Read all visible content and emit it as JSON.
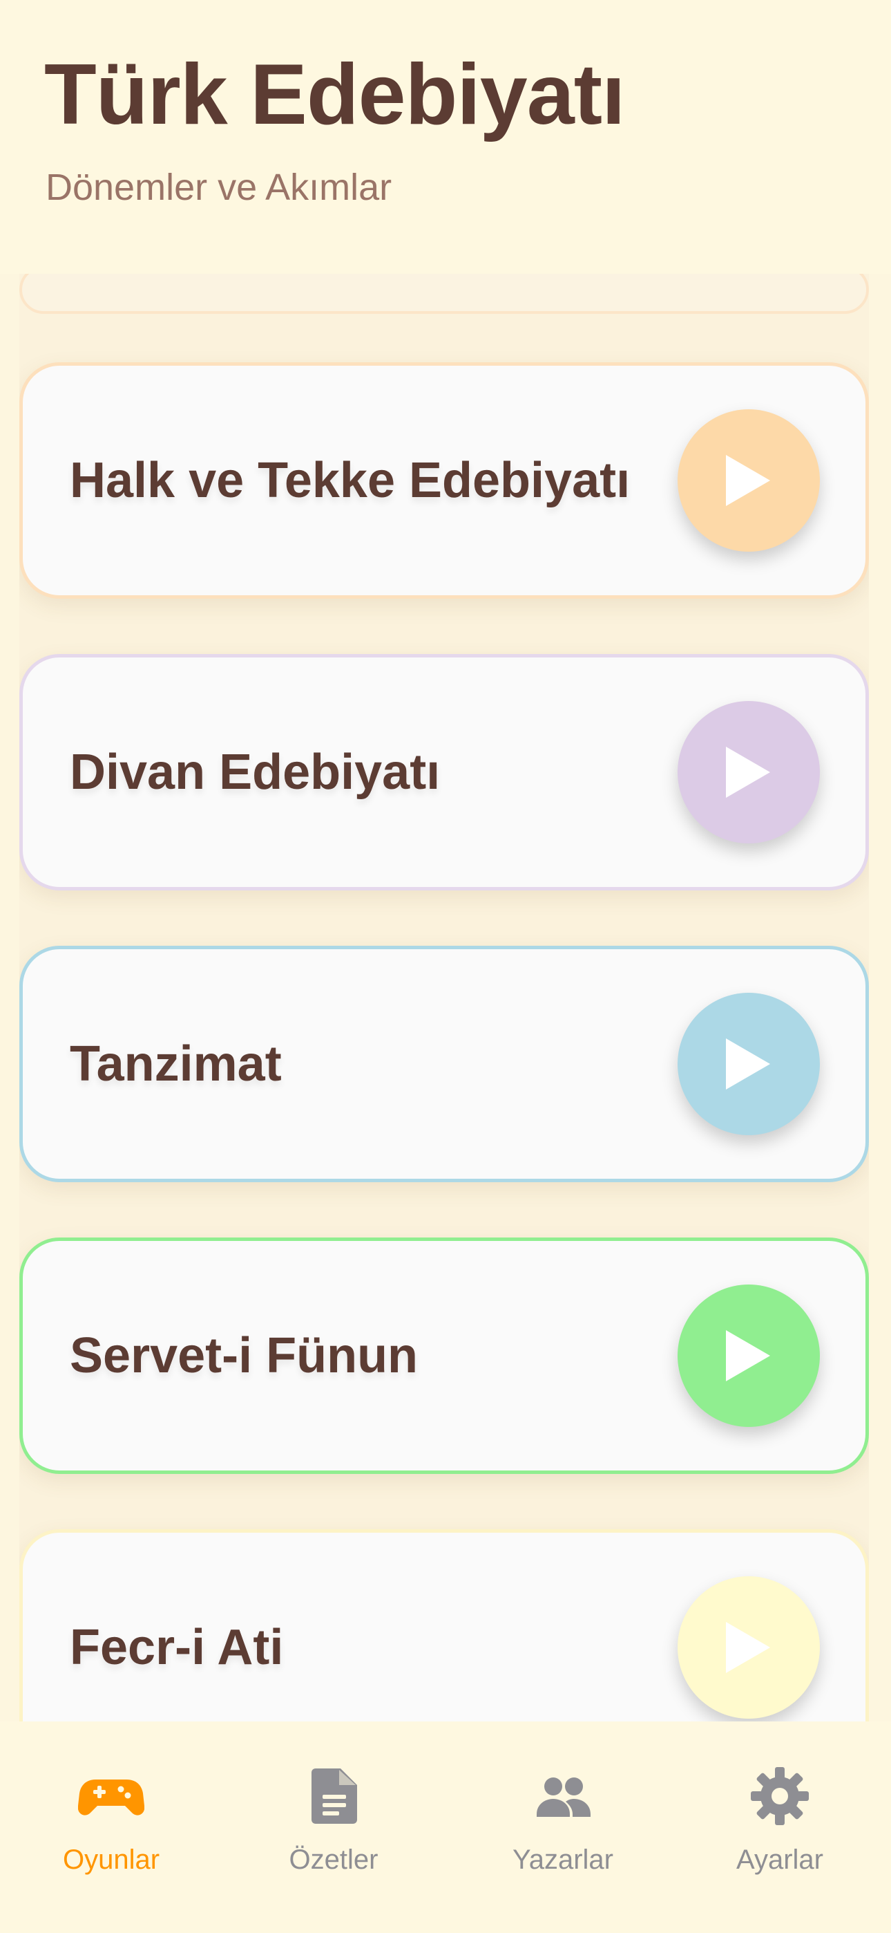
{
  "header": {
    "title": "Türk Edebiyatı",
    "subtitle": "Dönemler ve Akımlar"
  },
  "cards": [
    {
      "label": "Halk ve Tekke Edebiyatı",
      "accent": "#fdd9a8",
      "border": "#fde0bd",
      "play": "play-icon"
    },
    {
      "label": "Divan Edebiyatı",
      "accent": "#dccbe6",
      "border": "#e5d8ec",
      "play": "play-icon"
    },
    {
      "label": "Tanzimat",
      "accent": "#acd8e6",
      "border": "#acd8e6",
      "play": "play-icon"
    },
    {
      "label": "Servet-i Fünun",
      "accent": "#90ee90",
      "border": "#90ee90",
      "play": "play-icon"
    },
    {
      "label": "Fecr-i Ati",
      "accent": "#fffacd",
      "border": "#fdf3c6",
      "play": "play-icon"
    }
  ],
  "tabbar": {
    "active_color": "#ff9500",
    "inactive_color": "#8e8e93",
    "tabs": [
      {
        "label": "Oyunlar",
        "icon": "gamepad-icon",
        "active": true
      },
      {
        "label": "Özetler",
        "icon": "document-icon",
        "active": false
      },
      {
        "label": "Yazarlar",
        "icon": "people-icon",
        "active": false
      },
      {
        "label": "Ayarlar",
        "icon": "gear-icon",
        "active": false
      }
    ]
  }
}
